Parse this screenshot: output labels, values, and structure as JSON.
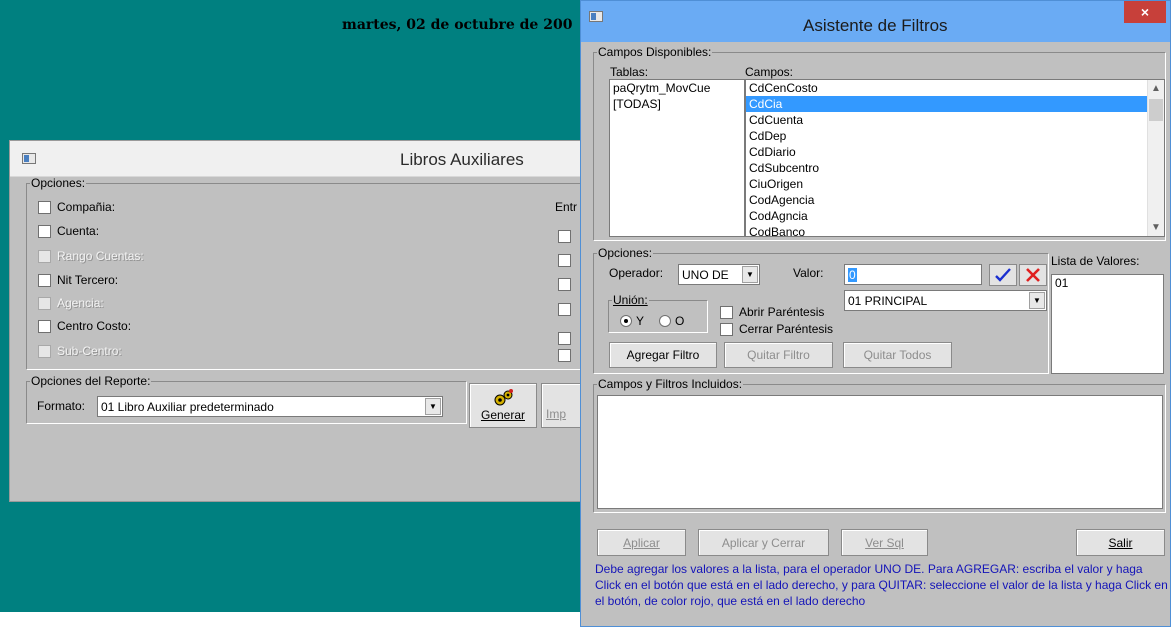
{
  "background": {
    "date": "martes, 02 de octubre de 200"
  },
  "libros": {
    "title": "Libros Auxiliares",
    "opciones_legend": "Opciones:",
    "options": [
      {
        "label": "Compañia:",
        "enabled": true
      },
      {
        "label": "Cuenta:",
        "enabled": true
      },
      {
        "label": "Rango Cuentas:",
        "enabled": false
      },
      {
        "label": "Nit Tercero:",
        "enabled": true
      },
      {
        "label": "Agencia:",
        "enabled": false
      },
      {
        "label": "Centro Costo:",
        "enabled": true
      },
      {
        "label": "Sub-Centro:",
        "enabled": false
      }
    ],
    "entre_label": "Entr",
    "reporte_legend": "Opciones del Reporte:",
    "formato_label": "Formato:",
    "formato_value": "01 Libro Auxiliar predeterminado",
    "generar_label": "Generar",
    "imprimir_label": "Imp"
  },
  "asistente": {
    "title": "Asistente de Filtros",
    "close_glyph": "×",
    "campos_legend": "Campos Disponibles:",
    "tablas_label": "Tablas:",
    "tablas": [
      "paQrytm_MovCue",
      "[TODAS]"
    ],
    "campos_label": "Campos:",
    "campos": [
      "CdCenCosto",
      "CdCia",
      "CdCuenta",
      "CdDep",
      "CdDiario",
      "CdSubcentro",
      "CiuOrigen",
      "CodAgencia",
      "CodAgncia",
      "CodBanco"
    ],
    "campos_selected": "CdCia",
    "opciones_legend": "Opciones:",
    "operador_label": "Operador:",
    "operador_value": "UNO DE",
    "valor_label": "Valor:",
    "valor_value": "0",
    "valor_select": "01  PRINCIPAL",
    "lista_label": "Lista de Valores:",
    "lista": [
      "01"
    ],
    "union_legend": "Unión:",
    "union_y": "Y",
    "union_o": "O",
    "abrir_label": "Abrir Paréntesis",
    "cerrar_label": "Cerrar Paréntesis",
    "agregar_label": "Agregar Filtro",
    "quitar_label": "Quitar Filtro",
    "quitar_todos_label": "Quitar Todos",
    "incluidos_legend": "Campos y Filtros Incluidos:",
    "aplicar_label": "Aplicar",
    "aplicar_cerrar_label": "Aplicar y Cerrar",
    "ver_sql_label": "Ver Sql",
    "salir_label": "Salir",
    "note": "Debe agregar los valores a la lista, para el operador UNO DE. Para AGREGAR: escriba el valor y haga Click en el botón que está en el lado derecho, y para QUITAR: seleccione el valor de la lista y haga Click en el botón, de color rojo, que está en el lado derecho"
  }
}
